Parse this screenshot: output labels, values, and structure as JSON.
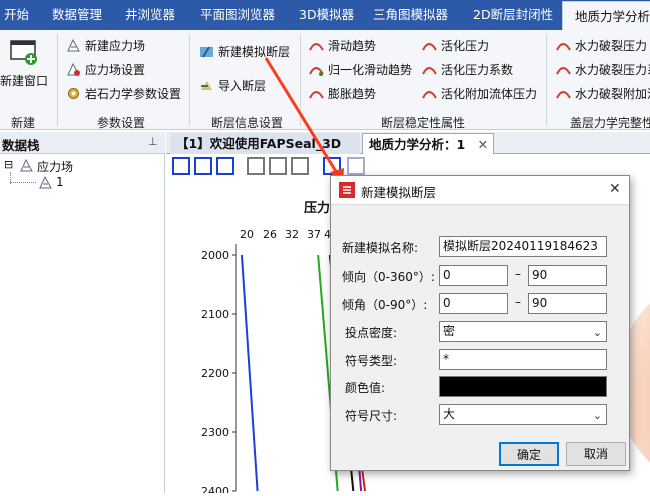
{
  "menu": [
    "开始",
    "数据管理",
    "井浏览器",
    "平面图浏览器",
    "3D模拟器",
    "三角图模拟器",
    "2D断层封闭性",
    "地质力学分析"
  ],
  "ribbon": {
    "groups": [
      "新建",
      "参数设置",
      "断层信息设置",
      "断层稳定性属性",
      "盖层力学完整性"
    ],
    "new_window": "新建窗口",
    "param_items": [
      "新建应力场",
      "应力场设置",
      "岩石力学参数设置"
    ],
    "fault_info_items": [
      "新建模拟断层",
      "导入断层"
    ],
    "stability_items": [
      "滑动趋势",
      "归一化滑动趋势",
      "膨胀趋势",
      "活化压力",
      "活化压力系数",
      "活化附加流体压力"
    ],
    "caprock_items": [
      "水力破裂压力",
      "水力破裂压力系",
      "水力破裂附加流"
    ]
  },
  "left_panel": {
    "title": "数据栈",
    "pin": "⊥",
    "tree": [
      {
        "label": "应力场",
        "toggle": "⊟"
      },
      {
        "label": "1"
      }
    ]
  },
  "tabs": [
    {
      "label": "【1】欢迎使用FAPSeal_3D"
    },
    {
      "label": "地质力学分析：1",
      "close": "✕"
    }
  ],
  "chart_data": {
    "type": "line",
    "title": "压力",
    "x_ticks": [
      "20",
      "26",
      "32",
      "37",
      "4"
    ],
    "y_ticks": [
      "2000",
      "2100",
      "2200",
      "2300",
      "2400"
    ],
    "ylim": [
      2000,
      2400
    ],
    "series": [
      {
        "color": "#1f3fd6",
        "x": [
          20.5,
          24.5
        ],
        "y": [
          2000,
          2400
        ]
      },
      {
        "color": "#22aa22",
        "x": [
          40.0,
          45.0
        ],
        "y": [
          2000,
          2400
        ]
      },
      {
        "color": "#111111",
        "x": [
          43.0,
          49.0
        ],
        "y": [
          2000,
          2400
        ]
      },
      {
        "color": "#cc2222",
        "x": [
          44.0,
          52.0
        ],
        "y": [
          2000,
          2400
        ]
      },
      {
        "color": "#7a1ca0",
        "x": [
          46.0,
          51.0
        ],
        "y": [
          2000,
          2400
        ]
      }
    ]
  },
  "dialog": {
    "title": "新建模拟断层",
    "close": "✕",
    "fields": {
      "name_label": "新建模拟名称:",
      "name_value": "模拟断层20240119184623",
      "strike_label": "倾向（0-360°）:",
      "strike_from": "0",
      "strike_to": "90",
      "dip_label": "倾角（0-90°）:",
      "dip_from": "0",
      "dip_to": "90",
      "range_sep": "–",
      "density_label": "投点密度:",
      "density_value": "密",
      "symbol_label": "符号类型:",
      "symbol_value": "*",
      "color_label": "颜色值:",
      "color_value": "#000000",
      "size_label": "符号尺寸:",
      "size_value": "大"
    },
    "ok": "确定",
    "cancel": "取消"
  },
  "colors": {
    "menubar": "#2d5aa8",
    "annotation_arrow": "#ff3b1f",
    "focus_blue": "#1a3fd6"
  }
}
